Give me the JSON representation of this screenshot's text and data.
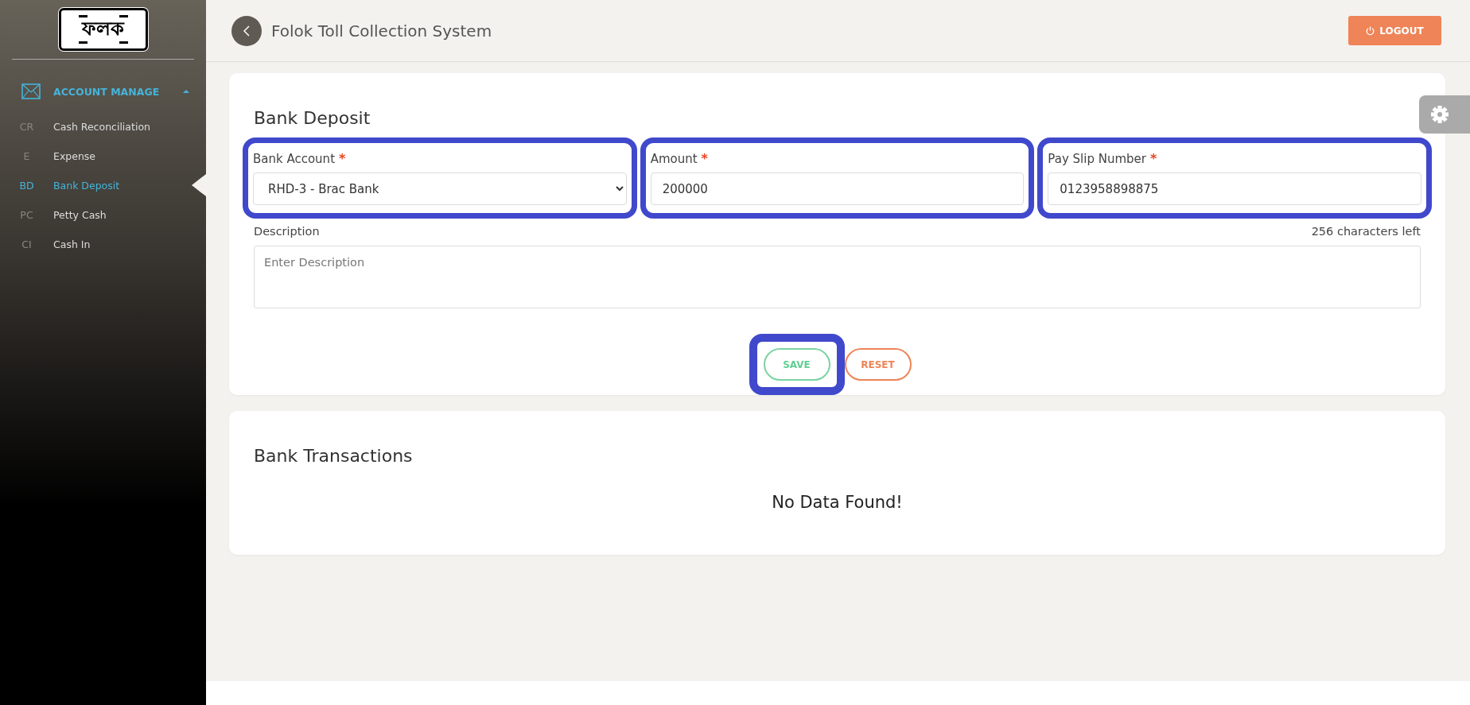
{
  "logo": {
    "text": "ফলক"
  },
  "sidebar": {
    "section": {
      "label": "ACCOUNT MANAGE",
      "expanded": true
    },
    "items": [
      {
        "abbr": "CR",
        "label": "Cash Reconciliation",
        "selected": false
      },
      {
        "abbr": "E",
        "label": "Expense",
        "selected": false
      },
      {
        "abbr": "BD",
        "label": "Bank Deposit",
        "selected": true
      },
      {
        "abbr": "PC",
        "label": "Petty Cash",
        "selected": false
      },
      {
        "abbr": "CI",
        "label": "Cash In",
        "selected": false
      }
    ]
  },
  "header": {
    "title": "Folok Toll Collection System",
    "logout": "LOGOUT"
  },
  "deposit": {
    "title": "Bank Deposit",
    "fields": [
      {
        "kind": "select",
        "label": "Bank Account",
        "required_mark": "*",
        "value": "RHD-3 - Brac Bank",
        "highlighted": true
      },
      {
        "kind": "input",
        "label": "Amount",
        "required_mark": "*",
        "value": "200000",
        "highlighted": true
      },
      {
        "kind": "input",
        "label": "Pay Slip Number",
        "required_mark": "*",
        "value": "0123958898875",
        "highlighted": true
      }
    ],
    "description": {
      "label": "Description",
      "counter": "256 characters left",
      "placeholder": "Enter Description"
    },
    "buttons": [
      {
        "kind": "save",
        "label": "SAVE",
        "highlighted": true
      },
      {
        "kind": "reset",
        "label": "RESET",
        "highlighted": false
      }
    ]
  },
  "transactions": {
    "title": "Bank Transactions",
    "empty": "No Data Found!"
  }
}
